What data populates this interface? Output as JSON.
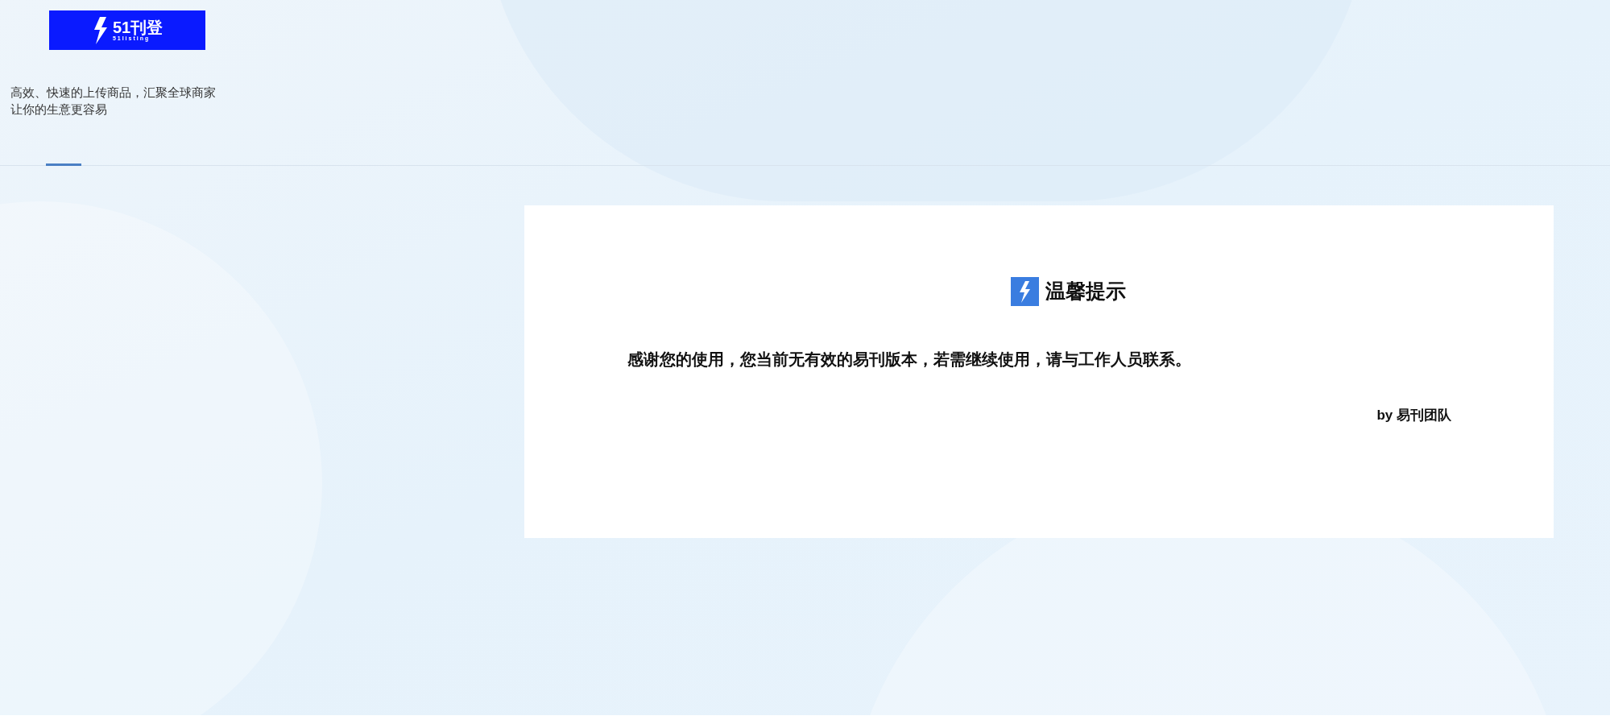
{
  "logo": {
    "name": "51刊登",
    "subtitle": "51listing"
  },
  "tagline": [
    "高效、快速的上传商品，汇聚全球商家",
    "让你的生意更容易"
  ],
  "dialog": {
    "title": "温馨提示",
    "message": "感谢您的使用，您当前无有效的易刊版本，若需继续使用，请与工作人员联系。",
    "signature": "by 易刊团队"
  }
}
